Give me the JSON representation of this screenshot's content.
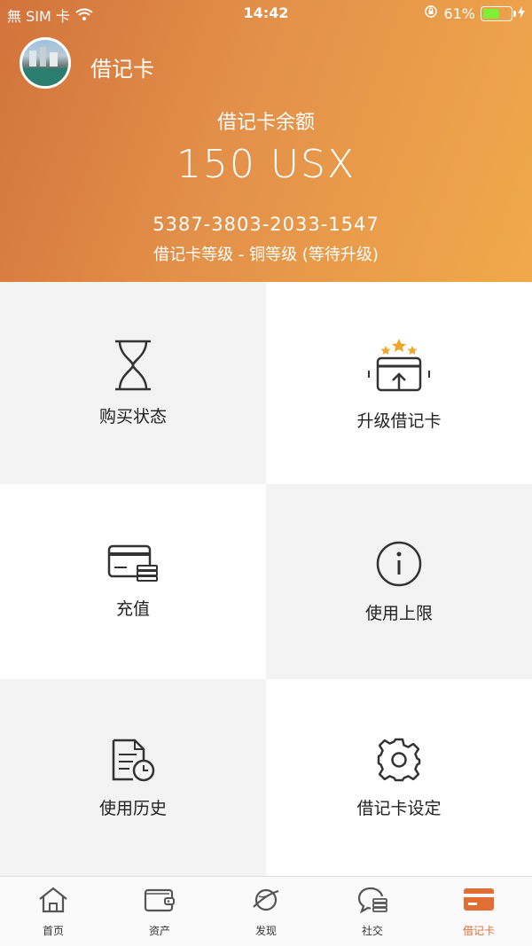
{
  "status_bar": {
    "carrier": "無 SIM 卡",
    "time": "14:42",
    "battery_percent": "61%",
    "battery_level": 0.61
  },
  "header": {
    "title": "借记卡",
    "balance_label": "借记卡余额",
    "balance_value": "150 USX",
    "card_number": "5387-3803-2033-1547",
    "card_level": "借记卡等级 - 铜等级 (等待升级)"
  },
  "grid": {
    "items": [
      {
        "label": "购买状态",
        "icon": "hourglass-icon"
      },
      {
        "label": "升级借记卡",
        "icon": "upgrade-card-icon"
      },
      {
        "label": "充值",
        "icon": "recharge-card-icon"
      },
      {
        "label": "使用上限",
        "icon": "info-icon"
      },
      {
        "label": "使用历史",
        "icon": "history-document-icon"
      },
      {
        "label": "借记卡设定",
        "icon": "gear-icon"
      }
    ]
  },
  "tabbar": {
    "tabs": [
      {
        "label": "首页",
        "icon": "home-icon"
      },
      {
        "label": "资产",
        "icon": "wallet-icon"
      },
      {
        "label": "发现",
        "icon": "planet-icon"
      },
      {
        "label": "社交",
        "icon": "chat-icon"
      },
      {
        "label": "借记卡",
        "icon": "card-icon",
        "active": true
      }
    ]
  },
  "colors": {
    "accent": "#e06e35",
    "header_start": "#d2733b",
    "header_end": "#f0a94a",
    "star": "#f0a52b"
  }
}
